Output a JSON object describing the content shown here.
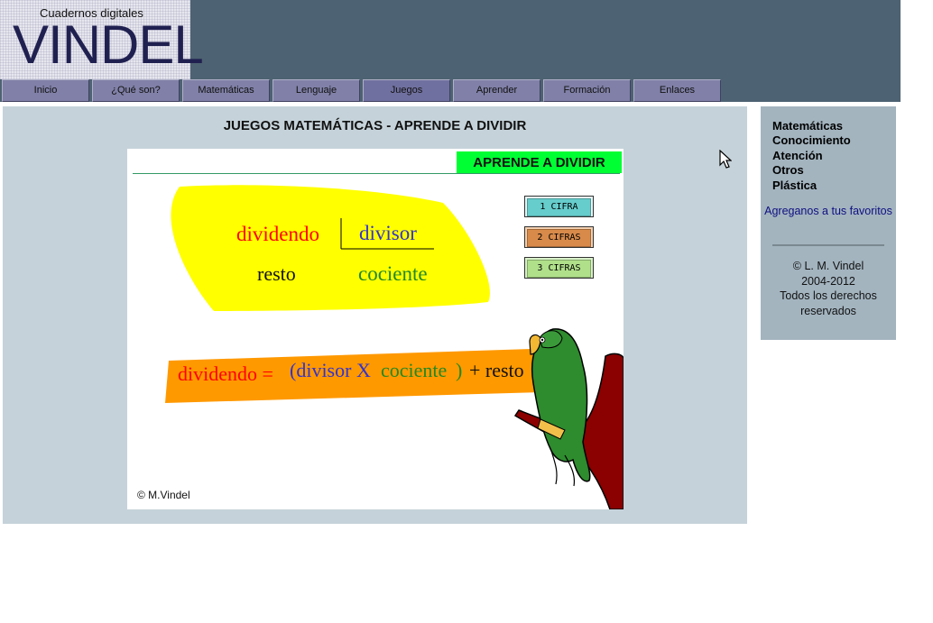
{
  "header": {
    "logo_subtitle": "Cuadernos digitales",
    "logo_title": "VINDEL"
  },
  "nav": {
    "items": [
      {
        "label": "Inicio"
      },
      {
        "label": "¿Qué son?"
      },
      {
        "label": "Matemáticas"
      },
      {
        "label": "Lenguaje"
      },
      {
        "label": "Juegos"
      },
      {
        "label": "Aprender"
      },
      {
        "label": "Formación"
      },
      {
        "label": "Enlaces"
      }
    ]
  },
  "main": {
    "title": "JUEGOS MATEMÁTICAS - APRENDE A DIVIDIR"
  },
  "game": {
    "banner": "APRENDE A DIVIDIR",
    "division": {
      "dividendo": "dividendo",
      "divisor": "divisor",
      "resto": "resto",
      "cociente": "cociente"
    },
    "formula": {
      "dividendo": "dividendo =",
      "open": "(divisor X",
      "cociente": "cociente",
      "close": ")",
      "plus_resto": "+ resto"
    },
    "buttons": [
      {
        "label": "1 CIFRA"
      },
      {
        "label": "2 CIFRAS"
      },
      {
        "label": "3 CIFRAS"
      }
    ],
    "copyright": "© M.Vindel"
  },
  "sidebar": {
    "links": [
      {
        "label": "Matemáticas"
      },
      {
        "label": "Conocimiento"
      },
      {
        "label": "Atención"
      },
      {
        "label": "Otros"
      },
      {
        "label": "Plástica"
      }
    ],
    "favorites": "Agreganos a tus favoritos",
    "copyright_lines": [
      "© L. M. Vindel",
      "2004-2012",
      "Todos los derechos",
      "reservados"
    ]
  },
  "colors": {
    "header_bg": "#4d6272",
    "nav_bg": "#8080a8",
    "main_bg": "#c5d2d9",
    "sidebar_bg": "#a3b4bf",
    "banner_green": "#00ff33",
    "yellow_blob": "#ffff00",
    "orange_strip": "#ff9900",
    "red_text": "#ff0000",
    "blue_text": "#3333cc",
    "green_text": "#228822"
  }
}
